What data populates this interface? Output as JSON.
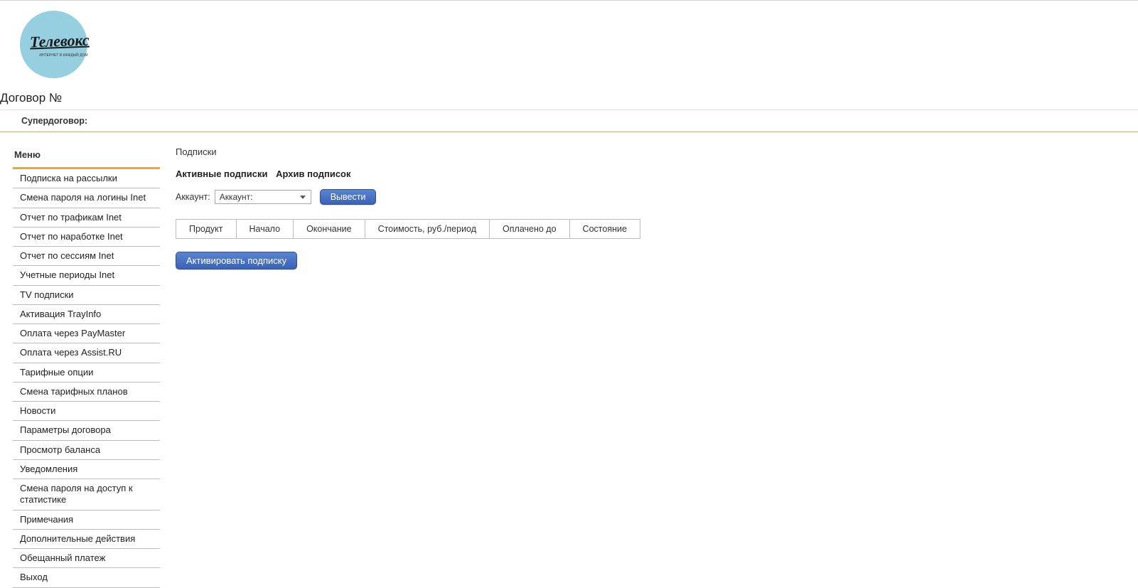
{
  "logo": {
    "brand": "Телевокс",
    "tagline": "ИНТЕРНЕТ\nВ КАЖДЫЙ ДОМ"
  },
  "header": {
    "contract_label": "Договор №",
    "super_label": "Супердоговор:"
  },
  "sidebar": {
    "title": "Меню",
    "items": [
      "Подписка на рассылки",
      "Смена пароля на логины Inet",
      "Отчет по трафикам Inet",
      "Отчет по наработке Inet",
      "Отчет по сессиям Inet",
      "Учетные периоды Inet",
      "TV подписки",
      "Активация TrayInfo",
      "Оплата через PayMaster",
      "Оплата через Assist.RU",
      "Тарифные опции",
      "Смена тарифных планов",
      "Новости",
      "Параметры договора",
      "Просмотр баланса",
      "Уведомления",
      "Смена пароля на доступ к статистике",
      "Примечания",
      "Дополнительные действия",
      "Обещанный платеж",
      "Выход"
    ]
  },
  "content": {
    "title": "Подписки",
    "tabs": {
      "active": "Активные подписки",
      "archive": "Архив подписок"
    },
    "filter": {
      "label": "Аккаунт:",
      "select_value": "Аккаунт:",
      "submit": "Вывести"
    },
    "table_headers": [
      "Продукт",
      "Начало",
      "Окончание",
      "Стоимость, руб./период",
      "Оплачено до",
      "Состояние"
    ],
    "activate_btn": "Активировать подписку"
  }
}
